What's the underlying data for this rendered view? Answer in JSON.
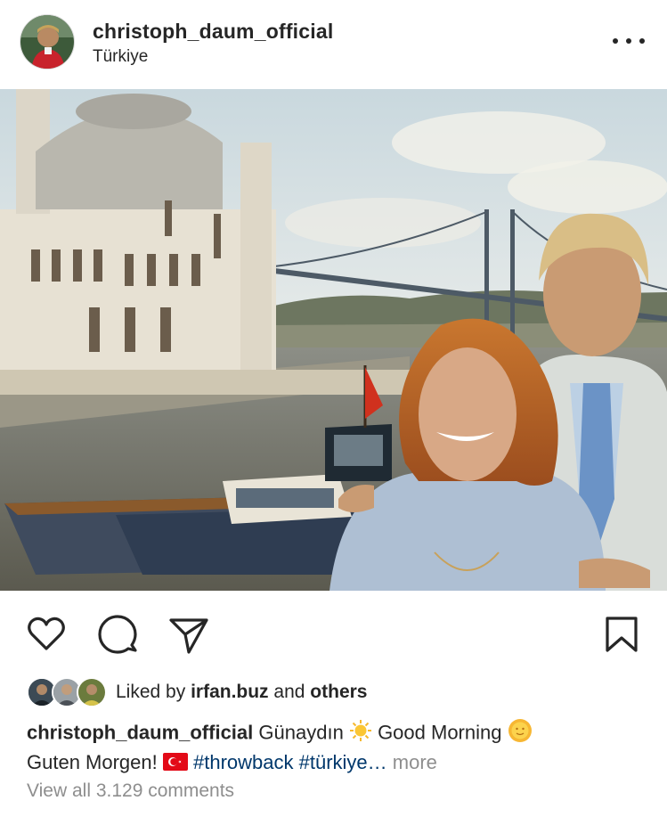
{
  "post": {
    "username": "christoph_daum_official",
    "location": "Türkiye",
    "more_menu_icon": "more-horizontal-icon"
  },
  "actions": {
    "icons": [
      "heart-icon",
      "comment-icon",
      "share-icon",
      "bookmark-icon"
    ]
  },
  "likes": {
    "prefix": "Liked by",
    "user": "irfan.buz",
    "conjunction": "and",
    "others": "others"
  },
  "caption": {
    "username": "christoph_daum_official",
    "text_1": "Günaydın",
    "text_2": "Good Morning",
    "text_3": "Guten Morgen!",
    "hashtags": "#throwback #türkiye…",
    "more": "more"
  },
  "comments": {
    "view_all": "View all 3.129 comments"
  },
  "colors": {
    "text": "#262626",
    "muted": "#8e8e8e",
    "hashtag": "#00376b"
  }
}
